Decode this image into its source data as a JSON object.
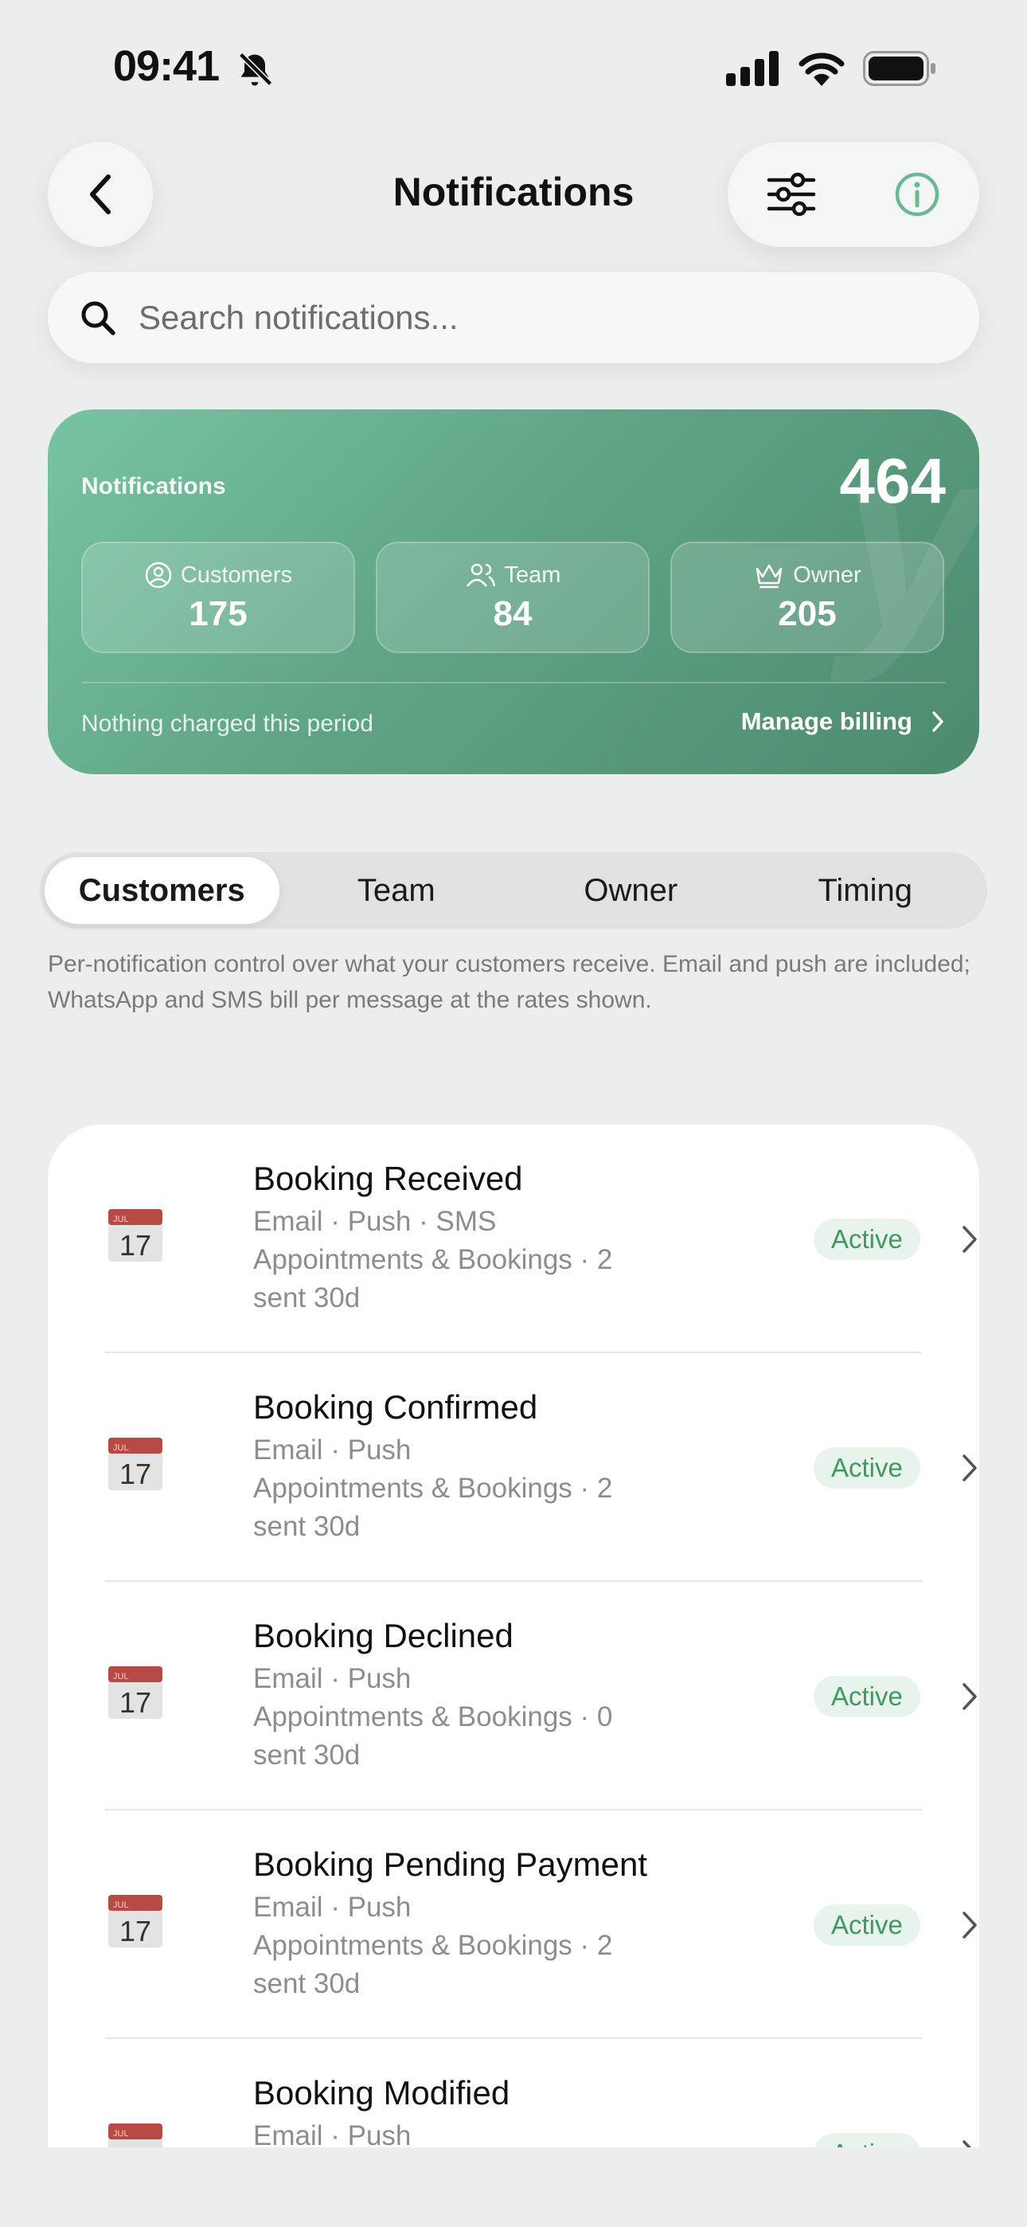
{
  "status_bar": {
    "time": "09:41"
  },
  "header": {
    "title": "Notifications"
  },
  "search": {
    "placeholder": "Search notifications..."
  },
  "summary": {
    "label": "Notifications",
    "total": "464",
    "stats": [
      {
        "label": "Customers",
        "value": "175",
        "icon": "person-circle-icon"
      },
      {
        "label": "Team",
        "value": "84",
        "icon": "people-icon"
      },
      {
        "label": "Owner",
        "value": "205",
        "icon": "crown-icon"
      }
    ],
    "footer_text": "Nothing charged this period",
    "manage_label": "Manage billing"
  },
  "tabs": [
    {
      "label": "Customers",
      "active": true
    },
    {
      "label": "Team",
      "active": false
    },
    {
      "label": "Owner",
      "active": false
    },
    {
      "label": "Timing",
      "active": false
    }
  ],
  "description": "Per-notification control over what your customers receive. Email and push are included; WhatsApp and SMS bill per message at the rates shown.",
  "notifications": [
    {
      "title": "Booking Received",
      "channels": "Email · Push · SMS",
      "meta": "Appointments & Bookings · 2 sent 30d",
      "status": "Active"
    },
    {
      "title": "Booking Confirmed",
      "channels": "Email · Push",
      "meta": "Appointments & Bookings · 2 sent 30d",
      "status": "Active"
    },
    {
      "title": "Booking Declined",
      "channels": "Email · Push",
      "meta": "Appointments & Bookings · 0 sent 30d",
      "status": "Active"
    },
    {
      "title": "Booking Pending Payment",
      "channels": "Email · Push",
      "meta": "Appointments & Bookings · 2 sent 30d",
      "status": "Active"
    },
    {
      "title": "Booking Modified",
      "channels": "Email · Push",
      "meta": "",
      "status": "Active"
    }
  ],
  "calendar_icon": {
    "month": "JUL",
    "day": "17"
  },
  "colors": {
    "accent": "#5fa485",
    "badge_text": "#3f9a62",
    "badge_bg": "#e8f3ec"
  }
}
